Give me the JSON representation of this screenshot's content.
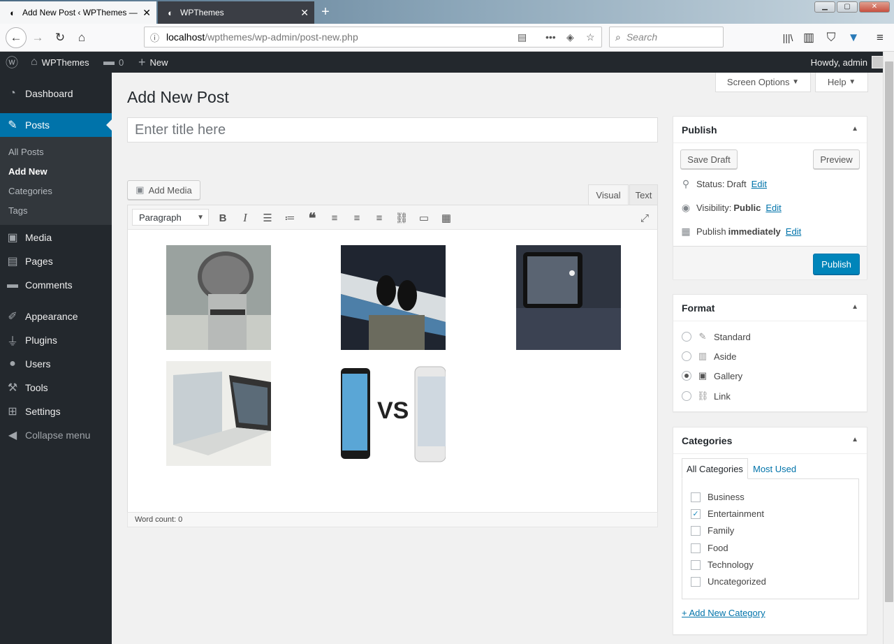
{
  "browser": {
    "tabs": [
      {
        "title": "Add New Post ‹ WPThemes —",
        "active": true
      },
      {
        "title": "WPThemes",
        "active": false
      }
    ],
    "url_host": "localhost",
    "url_path": "/wpthemes/wp-admin/post-new.php",
    "search_placeholder": "Search"
  },
  "admin_bar": {
    "site_name": "WPThemes",
    "comments_count": "0",
    "new_label": "New",
    "greeting": "Howdy, admin"
  },
  "sidebar": {
    "items": [
      {
        "label": "Dashboard",
        "icon": "dashboard-icon"
      },
      {
        "label": "Posts",
        "icon": "pin-icon",
        "current": true
      },
      {
        "label": "Media",
        "icon": "media-icon"
      },
      {
        "label": "Pages",
        "icon": "pages-icon"
      },
      {
        "label": "Comments",
        "icon": "comments-icon"
      },
      {
        "label": "Appearance",
        "icon": "brush-icon"
      },
      {
        "label": "Plugins",
        "icon": "plugin-icon"
      },
      {
        "label": "Users",
        "icon": "users-icon"
      },
      {
        "label": "Tools",
        "icon": "wrench-icon"
      },
      {
        "label": "Settings",
        "icon": "settings-icon"
      },
      {
        "label": "Collapse menu",
        "icon": "collapse-icon"
      }
    ],
    "submenu": [
      "All Posts",
      "Add New",
      "Categories",
      "Tags"
    ]
  },
  "screen_options": "Screen Options",
  "help": "Help",
  "page_title": "Add New Post",
  "title_placeholder": "Enter title here",
  "editor": {
    "add_media": "Add Media",
    "tab_visual": "Visual",
    "tab_text": "Text",
    "format": "Paragraph",
    "word_count": "Word count: 0",
    "vs_text": "VS"
  },
  "publish": {
    "heading": "Publish",
    "save_draft": "Save Draft",
    "preview": "Preview",
    "status_label": "Status:",
    "status_value": "Draft",
    "visibility_label": "Visibility:",
    "visibility_value": "Public",
    "schedule_label": "Publish",
    "schedule_value": "immediately",
    "edit": "Edit",
    "publish_button": "Publish"
  },
  "format_box": {
    "heading": "Format",
    "options": [
      {
        "label": "Standard",
        "checked": false
      },
      {
        "label": "Aside",
        "checked": false
      },
      {
        "label": "Gallery",
        "checked": true
      },
      {
        "label": "Link",
        "checked": false
      }
    ]
  },
  "categories_box": {
    "heading": "Categories",
    "tab_all": "All Categories",
    "tab_most": "Most Used",
    "items": [
      {
        "label": "Business",
        "checked": false
      },
      {
        "label": "Entertainment",
        "checked": true
      },
      {
        "label": "Family",
        "checked": false
      },
      {
        "label": "Food",
        "checked": false
      },
      {
        "label": "Technology",
        "checked": false
      },
      {
        "label": "Uncategorized",
        "checked": false
      }
    ],
    "add_new": "+ Add New Category"
  },
  "colors": {
    "admin_dark": "#23282d",
    "accent": "#0073aa",
    "publish_blue": "#0085ba"
  }
}
